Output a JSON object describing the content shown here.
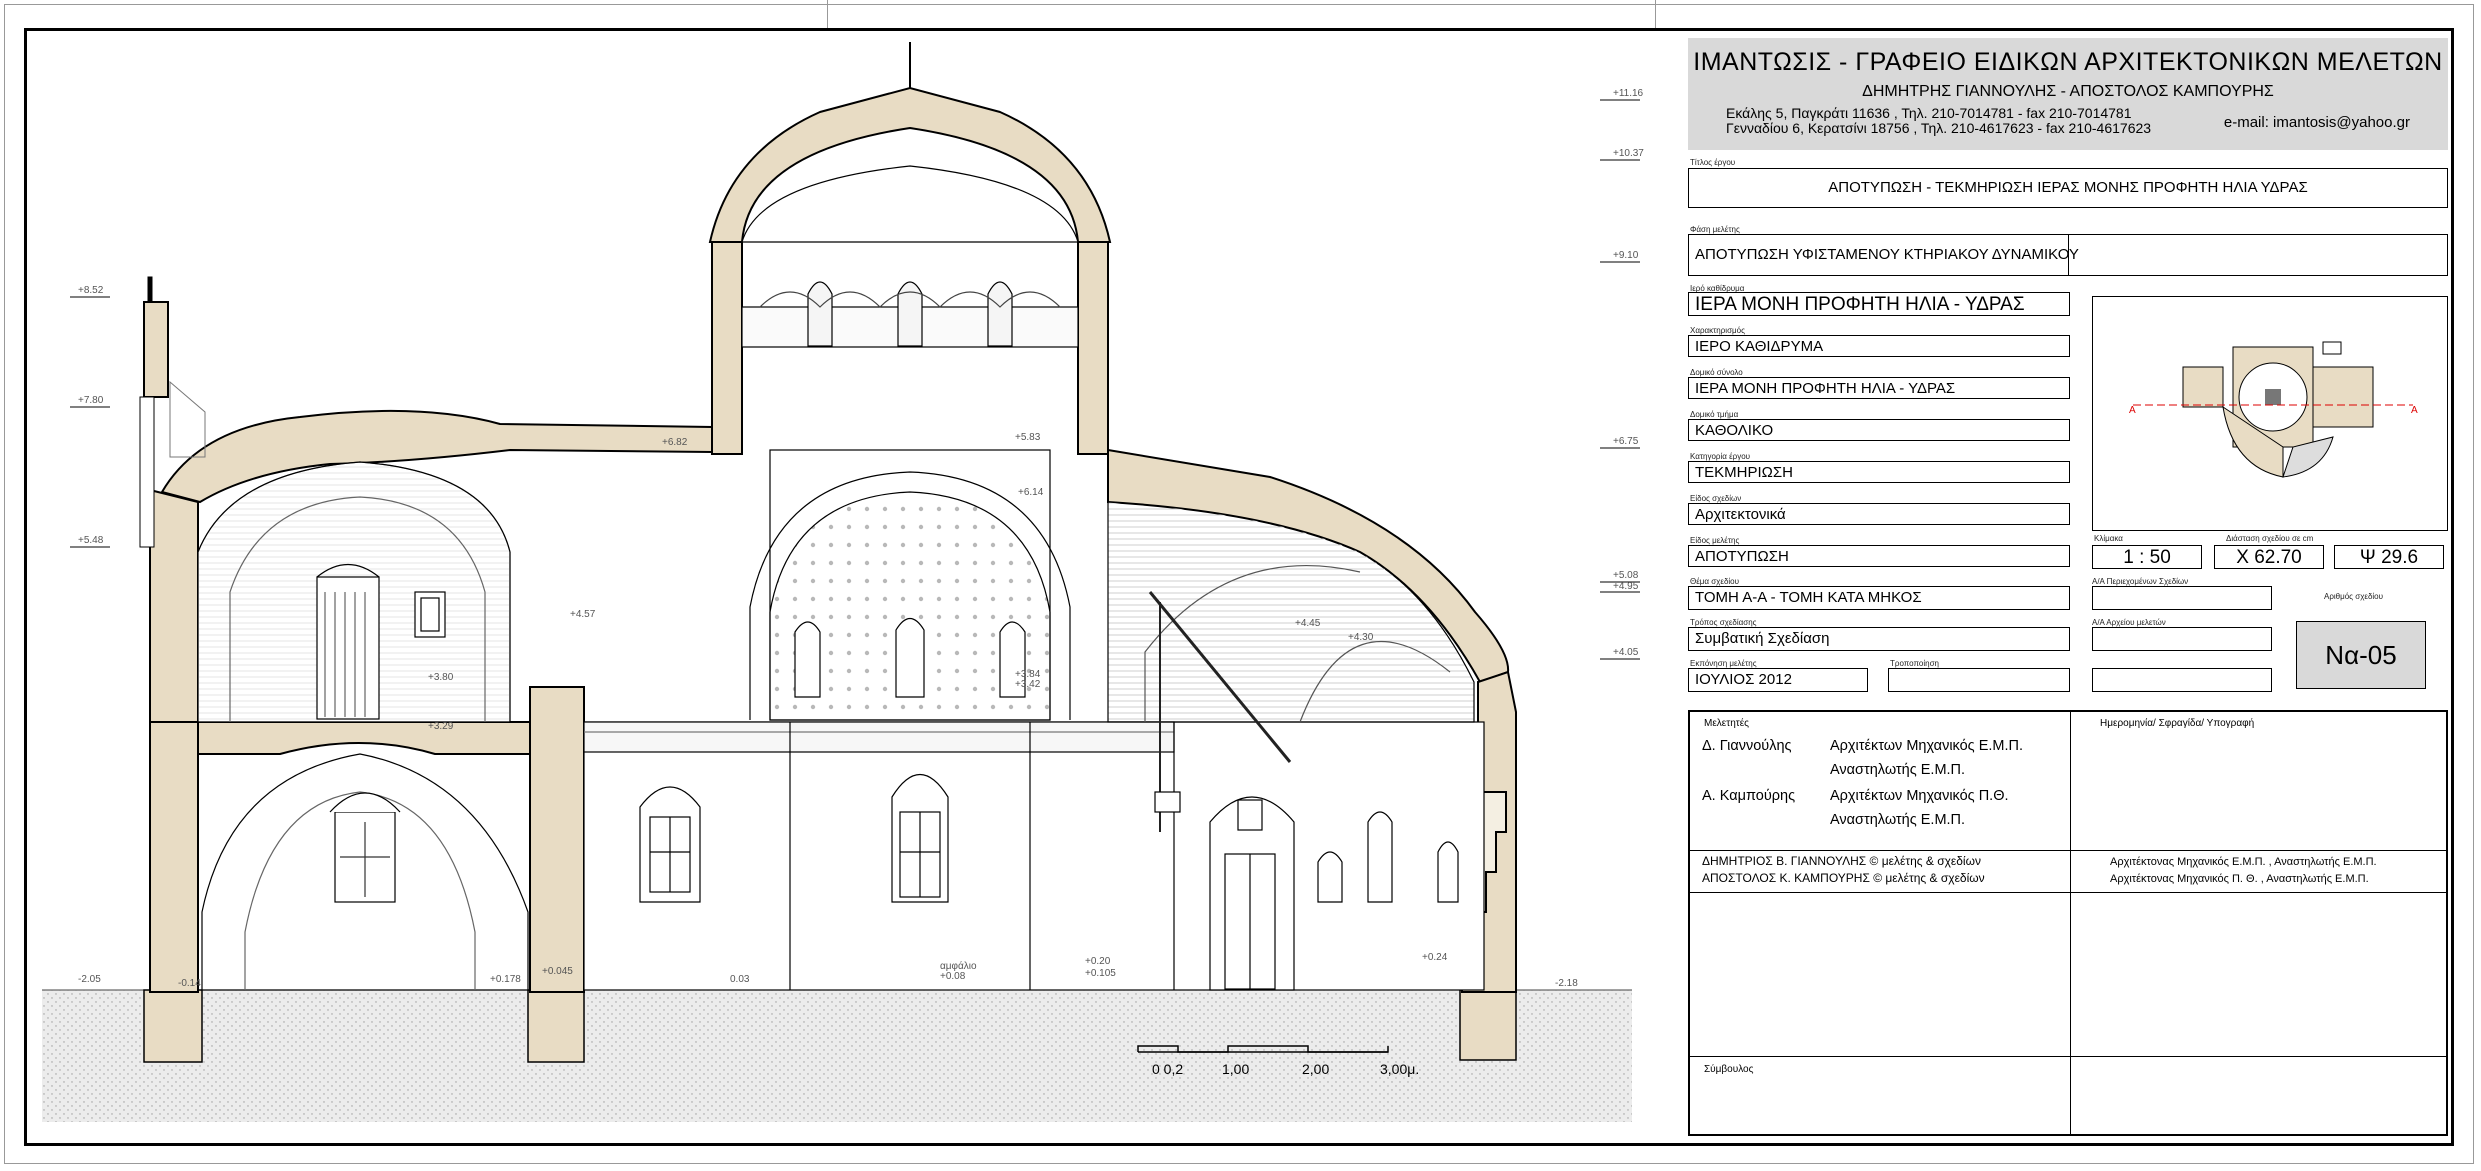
{
  "header": {
    "office": "ΙΜΑΝΤΩΣΙΣ - ΓΡΑΦΕΙΟ ΕΙΔΙΚΩΝ ΑΡΧΙΤΕΚΤΟΝΙΚΩΝ ΜΕΛΕΤΩΝ",
    "names": "ΔΗΜΗΤΡΗΣ ΓΙΑΝΝΟΥΛΗΣ  -  ΑΠΟΣΤΟΛΟΣ ΚΑΜΠΟΥΡΗΣ",
    "address1": "Εκάλης 5, Παγκράτι 11636 , Τηλ. 210-7014781 - fax 210-7014781",
    "address2": "Γενναδίου 6, Κερατσίνι 18756 , Τηλ. 210-4617623 - fax 210-4617623",
    "email": "e-mail: imantosis@yahoo.gr"
  },
  "fields": {
    "project_title_label": "Τίτλος έργου",
    "project_title": "ΑΠΟΤΥΠΩΣΗ - ΤΕΚΜΗΡΙΩΣΗ ΙΕΡΑΣ ΜΟΝΗΣ ΠΡΟΦΗΤΗ ΗΛΙΑ ΥΔΡΑΣ",
    "phase_label": "Φάση μελέτης",
    "phase": "ΑΠΟΤΥΠΩΣΗ ΥΦΙΣΤΑΜΕΝΟΥ ΚΤΗΡΙΑΚΟΥ ΔΥΝΑΜΙΚΟΥ",
    "foundation_label": "Ιερό καθίδρυμα",
    "foundation": "ΙΕΡΑ ΜΟΝΗ ΠΡΟΦΗΤΗ ΗΛΙΑ - ΥΔΡΑΣ",
    "character_label": "Χαρακτηρισμός",
    "character": "ΙΕΡΟ ΚΑΘΙΔΡΥΜΑ",
    "complex_label": "Δομικό σύνολο",
    "complex": "ΙΕΡΑ ΜΟΝΗ ΠΡΟΦΗΤΗ ΗΛΙΑ - ΥΔΡΑΣ",
    "part_label": "Δομικό τμήμα",
    "part": "ΚΑΘΟΛΙΚΟ",
    "category_label": "Κατηγορία έργου",
    "category": "ΤΕΚΜΗΡΙΩΣΗ",
    "drawing_type_label": "Είδος σχεδίων",
    "drawing_type": "Αρχιτεκτονικά",
    "study_type_label": "Είδος μελέτης",
    "study_type": "ΑΠΟΤΥΠΩΣΗ",
    "scale_label": "Κλίμακα",
    "scale": "1 : 50",
    "dims_label": "Διάσταση σχεδίου σε cm",
    "dim_x": "Χ 62.70",
    "dim_y": "Ψ 29.6",
    "subject_label": "Θέμα σχεδίου",
    "subject": "ΤΟΜΗ Α-Α  -  ΤΟΜΗ ΚΑΤΑ ΜΗΚΟΣ",
    "contained_label": "Α/Α Περιεχομένων Σχεδίων",
    "method_label": "Τρόπος σχεδίασης",
    "method": "Συμβατική Σχεδίαση",
    "archive_label": "Α/Α Αρχείου μελετών",
    "drawing_no_label": "Αριθμός σχεδίου",
    "drawing_no": "Να-05",
    "issue_label": "Εκπόνηση μελέτης",
    "issue": "ΙΟΥΛΙΟΣ  2012",
    "revision_label": "Τροποποίηση"
  },
  "signatures": {
    "authors_label": "Μελετητές",
    "date_label": "Ημερομηνία/ Σφραγίδα/ Υπογραφή",
    "author1_name": "Δ. Γιαννούλης",
    "author1_role1": "Αρχιτέκτων Μηχανικός Ε.Μ.Π.",
    "author1_role2": "Αναστηλωτής Ε.Μ.Π.",
    "author2_name": "Α. Καμπούρης",
    "author2_role1": "Αρχιτέκτων Μηχανικός Π.Θ.",
    "author2_role2": "Αναστηλωτής Ε.Μ.Π.",
    "copy1": "ΔΗΜΗΤΡΙΟΣ Β. ΓΙΑΝΝΟΥΛΗΣ  © μελέτης & σχεδίων",
    "copy2": "ΑΠΟΣΤΟΛΟΣ Κ. ΚΑΜΠΟΥΡΗΣ  © μελέτης & σχεδίων",
    "copy1_role": "Αρχιτέκτονας Μηχανικός Ε.Μ.Π. , Αναστηλωτής Ε.Μ.Π.",
    "copy2_role": "Αρχιτέκτονας Μηχανικός Π. Θ. ,  Αναστηλωτής Ε.Μ.Π.",
    "advisor_label": "Σύμβουλος"
  },
  "drawing": {
    "levels": [
      "+11.16",
      "+10.37",
      "+9.10",
      "+6.75",
      "+5.08",
      "+4.95",
      "+4.05",
      "+8.52",
      "+7.80",
      "+5.48",
      "+6.82",
      "+5.83",
      "+6.14",
      "+4.57",
      "+3.80",
      "+3.29",
      "+4.45",
      "+4.30",
      "+3.84",
      "+3.42",
      "-2.05",
      "-0.14",
      "+0.178",
      "+0.045",
      "0.03",
      "+0.20",
      "+0.105",
      "+0.24",
      "-2.18"
    ],
    "floor_label": "αμφάλιο",
    "floor_level": "+0.08",
    "scale_bar": [
      "0 0,2",
      "1,00",
      "2,00",
      "3,00μ."
    ]
  }
}
